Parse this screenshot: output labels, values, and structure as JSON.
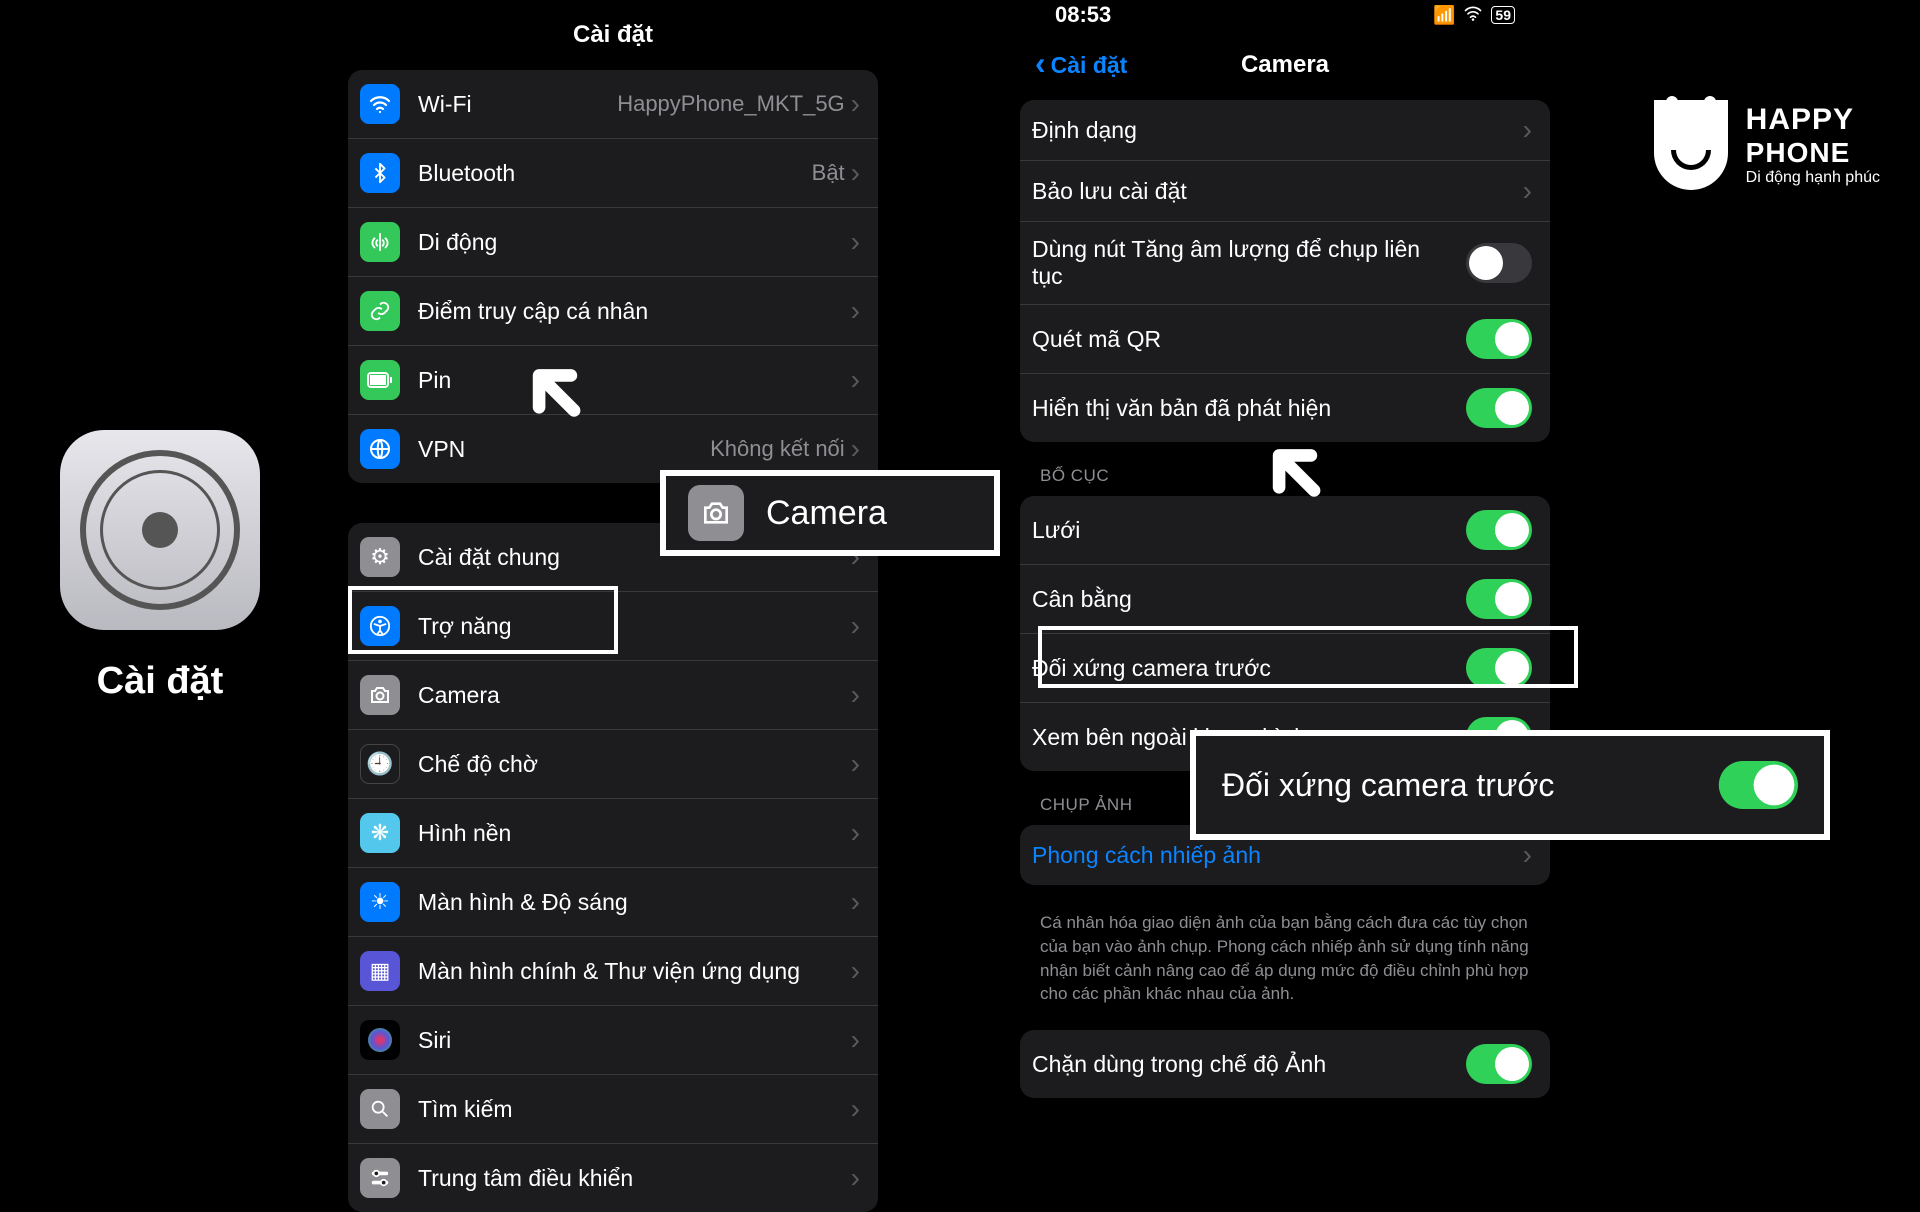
{
  "left_label": "Cài đặt",
  "brand": {
    "line1": "HAPPY",
    "line2": "PHONE",
    "line3": "Di động hạnh phúc"
  },
  "status": {
    "time": "08:53",
    "battery": "59"
  },
  "settings": {
    "title": "Cài đặt",
    "rows_network": [
      {
        "icon": "wifi",
        "label": "Wi-Fi",
        "value": "HappyPhone_MKT_5G"
      },
      {
        "icon": "bluetooth",
        "label": "Bluetooth",
        "value": "Bật"
      },
      {
        "icon": "antenna",
        "label": "Di động",
        "value": ""
      },
      {
        "icon": "link",
        "label": "Điểm truy cập cá nhân",
        "value": ""
      },
      {
        "icon": "battery",
        "label": "Pin",
        "value": ""
      },
      {
        "icon": "globe",
        "label": "VPN",
        "value": "Không kết nối"
      }
    ],
    "rows_general": [
      {
        "icon": "gear",
        "label": "Cài đặt chung"
      },
      {
        "icon": "accessibility",
        "label": "Trợ năng"
      },
      {
        "icon": "camera",
        "label": "Camera"
      },
      {
        "icon": "clock",
        "label": "Chế độ chờ"
      },
      {
        "icon": "flower",
        "label": "Hình nền"
      },
      {
        "icon": "sun",
        "label": "Màn hình & Độ sáng"
      },
      {
        "icon": "grid",
        "label": "Màn hình chính & Thư viện ứng dụng"
      },
      {
        "icon": "siri",
        "label": "Siri"
      },
      {
        "icon": "search",
        "label": "Tìm kiếm"
      },
      {
        "icon": "sliders",
        "label": "Trung tâm điều khiển"
      }
    ]
  },
  "camera": {
    "back_label": "Cài đặt",
    "title": "Camera",
    "rows_top": [
      {
        "label": "Định dạng",
        "type": "link"
      },
      {
        "label": "Bảo lưu cài đặt",
        "type": "link"
      },
      {
        "label": "Dùng nút Tăng âm lượng để chụp liên tục",
        "type": "toggle",
        "on": false
      },
      {
        "label": "Quét mã QR",
        "type": "toggle",
        "on": true
      },
      {
        "label": "Hiển thị văn bản đã phát hiện",
        "type": "toggle",
        "on": true
      }
    ],
    "section_layout": "BỐ CỤC",
    "rows_layout": [
      {
        "label": "Lưới",
        "type": "toggle",
        "on": true
      },
      {
        "label": "Cân bằng",
        "type": "toggle",
        "on": true
      },
      {
        "label": "Đối xứng camera trước",
        "type": "toggle",
        "on": true
      },
      {
        "label": "Xem bên ngoài khung hình",
        "type": "toggle",
        "on": true
      }
    ],
    "section_capture": "CHỤP ẢNH",
    "photo_styles": "Phong cách nhiếp ảnh",
    "photo_styles_footer": "Cá nhân hóa giao diện ảnh của bạn bằng cách đưa các tùy chọn của bạn vào ảnh chụp. Phong cách nhiếp ảnh sử dụng tính năng nhận biết cảnh nâng cao để áp dụng mức độ điều chỉnh phù hợp cho các phần khác nhau của ảnh.",
    "bottom_row": "Chặn dùng trong chế độ Ảnh"
  },
  "callout_camera": "Camera",
  "callout_mirror": "Đối xứng camera trước"
}
